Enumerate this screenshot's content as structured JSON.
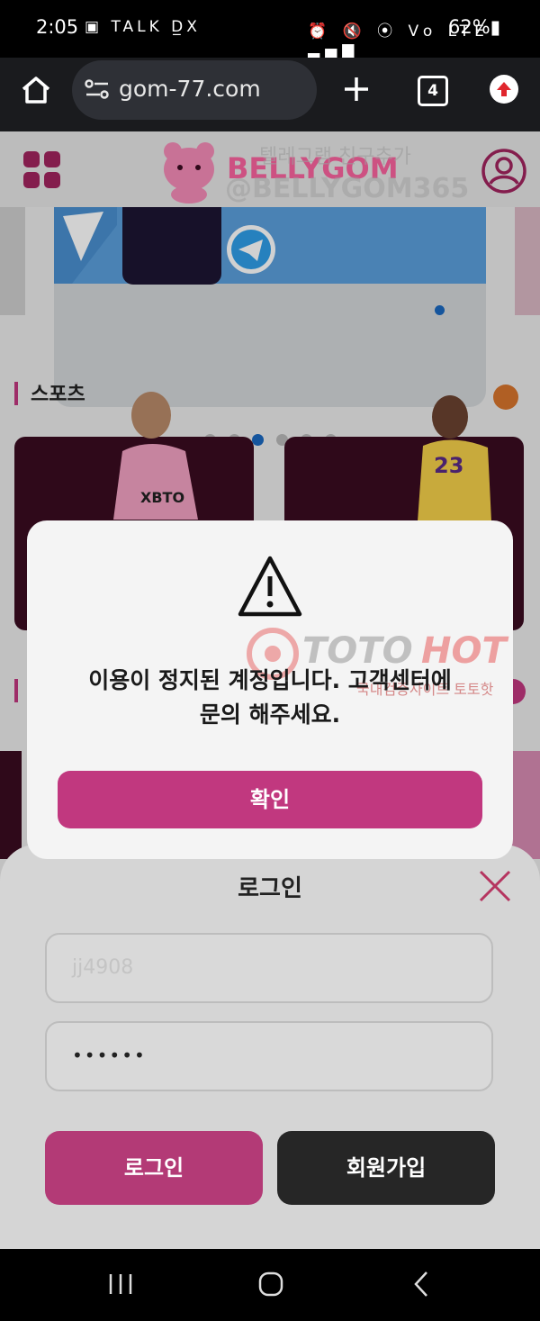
{
  "status_bar": {
    "time": "2:05",
    "left_icons": "▣ TALK D̲X",
    "right_icons": "⏰ 🔇 ⦿ Vo LTE ▂▄▆",
    "battery": "62%▮"
  },
  "browser": {
    "url": "gom-77.com",
    "tab_count": "4"
  },
  "site": {
    "logo_text": "BELLYGOM",
    "banner_overlay_line1": "텔레그램 친구추가",
    "banner_overlay_line2": "@BELLYGOM365",
    "section_sports": "스포츠",
    "jersey_text": "XBTO",
    "jersey_number": "23"
  },
  "dialog": {
    "message_line1": "이용이 정지된 계정입니다. 고객센터에",
    "message_line2": "문의 해주세요.",
    "confirm_label": "확인"
  },
  "watermark": {
    "brand_a": "TOTO",
    "brand_b": "HOT",
    "tagline": "국내검증사이트 토토핫"
  },
  "login": {
    "title": "로그인",
    "username_value": "jj4908",
    "password_value": "••••••",
    "login_label": "로그인",
    "signup_label": "회원가입"
  },
  "colors": {
    "accent": "#c1387f",
    "brand_pink": "#ff3d88",
    "dark_button": "#2a2a2a"
  }
}
